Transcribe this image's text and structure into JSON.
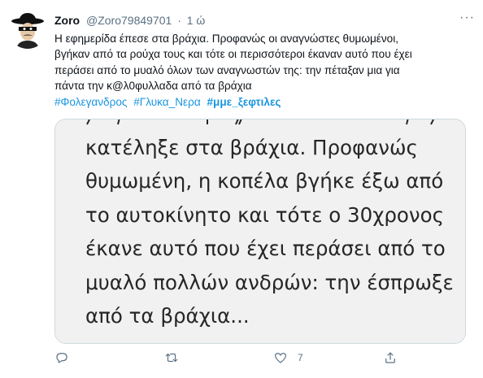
{
  "tweet": {
    "name": "Zoro",
    "handle": "@Zoro79849701",
    "separator": "·",
    "time": "1 ώ",
    "more": "···",
    "text_lines": [
      "Η εφημερίδα έπεσε  στα βράχια. Προφανώς οι αναγνώστες θυμωμένοι,",
      "βγήκαν από τα ρούχα τους και τότε οι περισσότεροι έκαναν αυτό που έχει",
      "περάσει από το μυαλό όλων των αναγνωστών της: την πέταξαν μια για",
      "πάντα την κ@λ0φυλλαδα  από τα βράχια"
    ],
    "hashtags": [
      "#Φολεγανδρος",
      "#Γλυκα_Νερα",
      "#μμε_ξεφτιλες"
    ]
  },
  "media": {
    "lines": [
      "κατέληξε στα βράχια. Προφανώς",
      "θυμωμένη, η κοπέλα βγήκε έξω από",
      "το αυτοκίνητο και τότε ο 30χρονος",
      "έκανε αυτό που έχει περάσει από το",
      "μυαλό πολλών ανδρών: την έσπρωξε",
      "από τα βράχια..."
    ]
  },
  "actions": {
    "reply_icon": "reply-icon",
    "retweet_icon": "retweet-icon",
    "like_icon": "heart-icon",
    "like_count": "7",
    "share_icon": "share-icon"
  },
  "colors": {
    "hashtag": "#1b95e0",
    "secondary_text": "#5b7083",
    "border": "#cfd9de"
  }
}
